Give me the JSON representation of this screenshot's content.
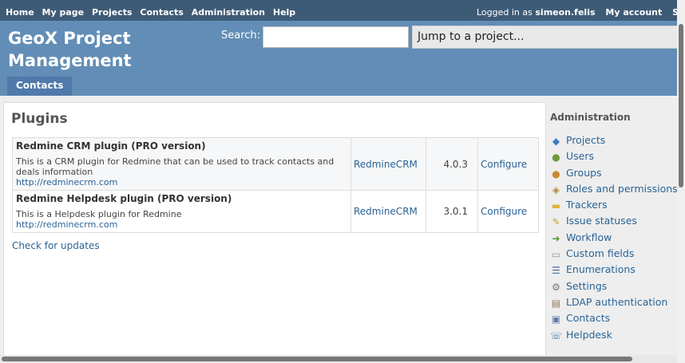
{
  "top_menu": {
    "items": [
      "Home",
      "My page",
      "Projects",
      "Contacts",
      "Administration",
      "Help"
    ],
    "logged_in_prefix": "Logged in as",
    "user": "simeon.felis",
    "my_account": "My account",
    "sign_out": "Sign out"
  },
  "header": {
    "title": "GeoX Project Management",
    "search_label": "Search:",
    "search_value": "",
    "jump_label": "Jump to a project..."
  },
  "main_menu": {
    "tab": "Contacts"
  },
  "content": {
    "title": "Plugins",
    "plugins": [
      {
        "name": "Redmine CRM plugin (PRO version)",
        "description": "This is a CRM plugin for Redmine that can be used to track contacts and deals information",
        "url": "http://redminecrm.com",
        "author": "RedmineCRM",
        "version": "4.0.3",
        "configure": "Configure"
      },
      {
        "name": "Redmine Helpdesk plugin (PRO version)",
        "description": "This is a Helpdesk plugin for Redmine",
        "url": "http://redminecrm.com",
        "author": "RedmineCRM",
        "version": "3.0.1",
        "configure": "Configure"
      }
    ],
    "check_updates": "Check for updates"
  },
  "sidebar": {
    "title": "Administration",
    "items": [
      {
        "label": "Projects",
        "icon": "projects-icon",
        "glyph": "◆",
        "color": "#3b7dc4"
      },
      {
        "label": "Users",
        "icon": "user-icon",
        "glyph": "●",
        "color": "#6a9a3a"
      },
      {
        "label": "Groups",
        "icon": "group-icon",
        "glyph": "●",
        "color": "#c98a2f"
      },
      {
        "label": "Roles and permissions",
        "icon": "key-icon",
        "glyph": "◈",
        "color": "#b08a3a"
      },
      {
        "label": "Trackers",
        "icon": "ticket-icon",
        "glyph": "▬",
        "color": "#e2b13c"
      },
      {
        "label": "Issue statuses",
        "icon": "status-icon",
        "glyph": "✎",
        "color": "#c9a234"
      },
      {
        "label": "Workflow",
        "icon": "workflow-icon",
        "glyph": "➜",
        "color": "#4f9a3a"
      },
      {
        "label": "Custom fields",
        "icon": "textfield-icon",
        "glyph": "▭",
        "color": "#999999"
      },
      {
        "label": "Enumerations",
        "icon": "list-icon",
        "glyph": "☰",
        "color": "#4a6a9a"
      },
      {
        "label": "Settings",
        "icon": "gear-icon",
        "glyph": "⚙",
        "color": "#777777"
      },
      {
        "label": "LDAP authentication",
        "icon": "server-icon",
        "glyph": "▤",
        "color": "#8a7a5a"
      },
      {
        "label": "Contacts",
        "icon": "contact-card-icon",
        "glyph": "▣",
        "color": "#5a7aaa"
      },
      {
        "label": "Helpdesk",
        "icon": "helpdesk-icon",
        "glyph": "☏",
        "color": "#4a7ac4"
      }
    ]
  }
}
